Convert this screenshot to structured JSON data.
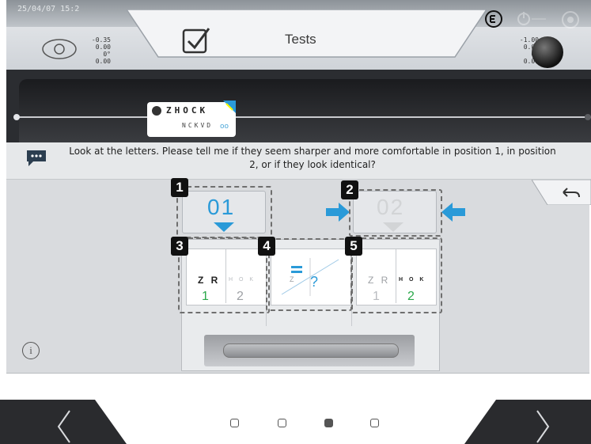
{
  "header": {
    "datetime": "25/04/07   15:2",
    "title": "Tests",
    "left_values": [
      "-0.35",
      "0.00",
      "0°",
      "0.00"
    ],
    "right_values": [
      "-1.00",
      "0.00",
      "0°",
      "0.00"
    ],
    "icons": [
      "eye-icon",
      "checkbox-icon",
      "mode-icon",
      "power-icon",
      "settings-icon"
    ]
  },
  "chart_preview": {
    "row1": "ZHOCK",
    "row2": "NCKVD",
    "dots": "oo"
  },
  "instruction": "Look at the letters. Please tell me if they seem sharper and more comfortable in position 1, in position 2, or if they look identical?",
  "positions": {
    "pos1_label": "01",
    "pos2_label": "02",
    "active": 1
  },
  "comparison": {
    "card1": {
      "strong": "Z R",
      "faint": "H O K",
      "num_left": "1",
      "num_right": "2"
    },
    "card3": {
      "strong": "Z R",
      "faint": "H O K",
      "num_left": "1",
      "num_right": "2"
    }
  },
  "badges": [
    "1",
    "2",
    "3",
    "4",
    "5"
  ],
  "info_label": "i",
  "pagination": {
    "pages": 4,
    "current": 3
  },
  "colors": {
    "accent_blue": "#2a9ad8",
    "green": "#2aa84a",
    "badge": "#111111"
  }
}
